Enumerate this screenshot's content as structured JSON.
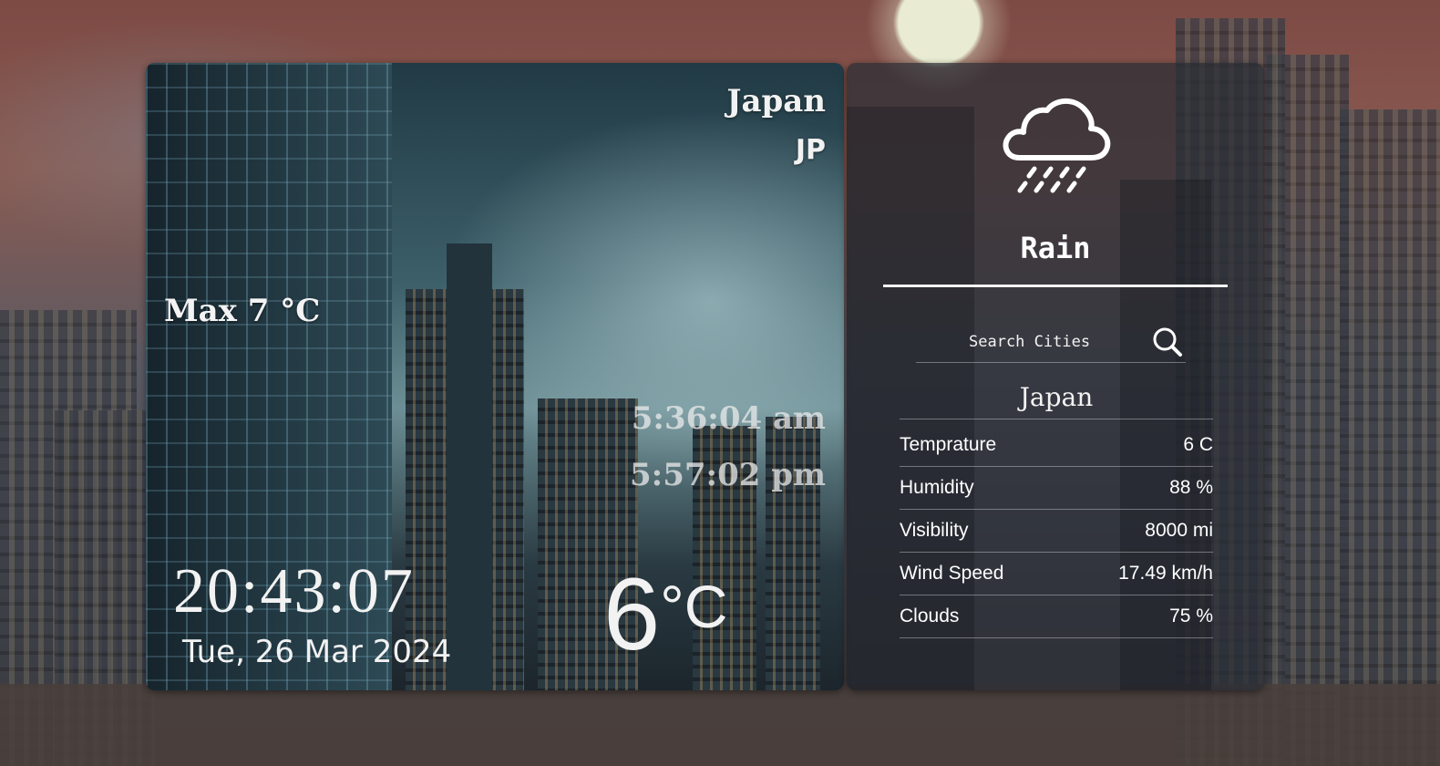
{
  "left_card": {
    "country": "Japan",
    "country_code": "JP",
    "max_temp": "Max 7 °C",
    "sunrise": "5:36:04 am",
    "sunset": "5:57:02 pm",
    "time": "20:43:07",
    "date": "Tue, 26 Mar 2024",
    "temperature": "6",
    "temperature_unit": "°C"
  },
  "right_card": {
    "weather_icon": "cloud-rain-icon",
    "condition": "Rain",
    "search": {
      "placeholder": "Search Cities",
      "button_icon": "search-icon"
    },
    "city": "Japan",
    "details": [
      {
        "label": "Temprature",
        "value": "6 C"
      },
      {
        "label": "Humidity",
        "value": "88 %"
      },
      {
        "label": "Visibility",
        "value": "8000 mi"
      },
      {
        "label": "Wind Speed",
        "value": "17.49 km/h"
      },
      {
        "label": "Clouds",
        "value": "75 %"
      }
    ]
  },
  "colors": {
    "text": "#f2f2f2",
    "panel": "#282c34"
  }
}
